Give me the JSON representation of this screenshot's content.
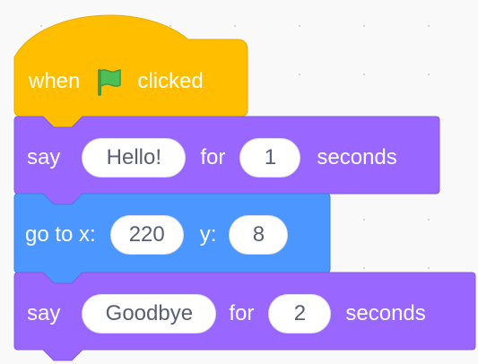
{
  "script": {
    "hat": {
      "label_when": "when",
      "icon": "green-flag-icon",
      "label_clicked": "clicked",
      "color": "#ffbf00"
    },
    "say1": {
      "label": "say",
      "message": "Hello!",
      "label_for": "for",
      "secs": "1",
      "label_seconds": "seconds",
      "color": "#9966ff"
    },
    "goto": {
      "label": "go to x:",
      "x": "220",
      "label_y": "y:",
      "y": "8",
      "color": "#4c97ff"
    },
    "say2": {
      "label": "say",
      "message": "Goodbye",
      "label_for": "for",
      "secs": "2",
      "label_seconds": "seconds",
      "color": "#9966ff"
    }
  }
}
